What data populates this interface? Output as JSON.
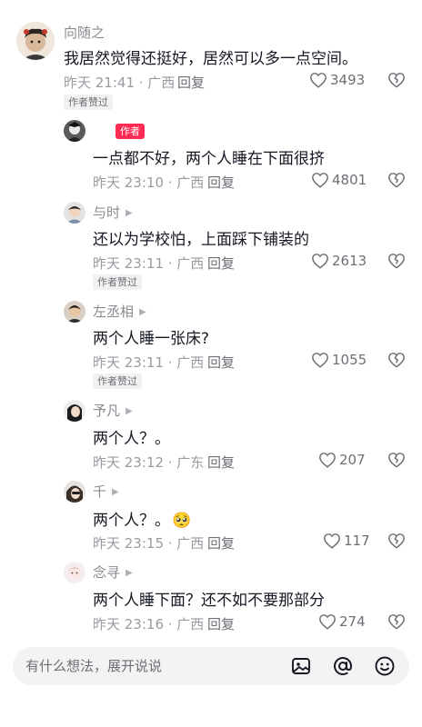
{
  "comments": [
    {
      "user": "向随之",
      "text": "我居然觉得还挺好，居然可以多一点空间。",
      "time": "昨天 21:41 · 广西",
      "reply": "回复",
      "likes": "3493",
      "badge": "作者赞过"
    },
    {
      "user": "",
      "author_tag": "作者",
      "text": "一点都不好，两个人睡在下面很挤",
      "time": "昨天 23:10 · 广西",
      "reply": "回复",
      "likes": "4801"
    },
    {
      "user": "与时",
      "text": "还以为学校怕，上面踩下铺装的",
      "time": "昨天 23:11 · 广西",
      "reply": "回复",
      "likes": "2613",
      "badge": "作者赞过"
    },
    {
      "user": "左丞相",
      "text": "两个人睡一张床?",
      "time": "昨天 23:11 · 广西",
      "reply": "回复",
      "likes": "1055",
      "badge": "作者赞过"
    },
    {
      "user": "予凡",
      "text": "两个人？。",
      "time": "昨天 23:12 · 广东",
      "reply": "回复",
      "likes": "207"
    },
    {
      "user": "千",
      "text": "两个人？。",
      "emoji": "🥺",
      "time": "昨天 23:15 · 广西",
      "reply": "回复",
      "likes": "117"
    },
    {
      "user": "念寻",
      "text": "两个人睡下面？还不如不要那部分",
      "time": "昨天 23:16 · 广西",
      "reply": "回复",
      "likes": "274"
    }
  ],
  "input": {
    "placeholder": "有什么想法，展开说说"
  },
  "icons": {
    "image": "image-icon",
    "mention": "at-mention-icon",
    "emoji": "emoji-icon",
    "like": "heart-outline-icon",
    "dislike": "broken-heart-icon"
  },
  "colors": {
    "author_tag": "#fe2c55",
    "meta": "#9a9ba1",
    "text": "#161823"
  }
}
